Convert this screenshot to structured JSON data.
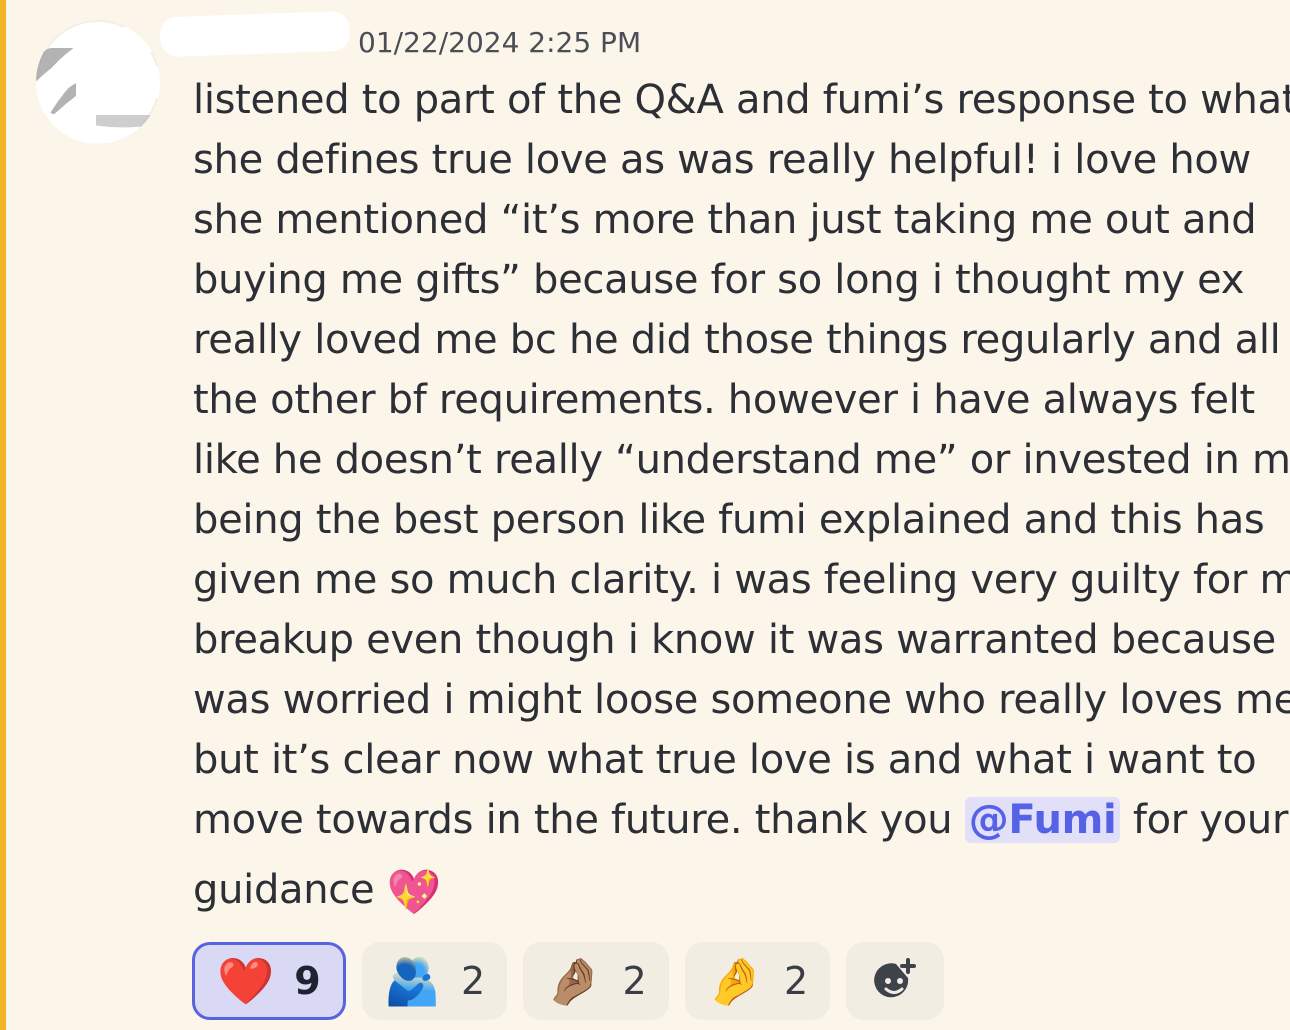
{
  "message": {
    "timestamp": "01/22/2024 2:25 PM",
    "lines": [
      "listened to part of the Q&A and fumi’s response to what",
      "she defines true love as was really helpful! i love how",
      "she mentioned “it’s more than just taking me out and",
      "buying me gifts” because for so long i thought my ex",
      "really loved me bc he did those things regularly and all",
      "the other bf requirements. however i have always felt",
      "like he doesn’t really “understand me” or invested in me",
      "being the best person like fumi explained and this has",
      "given me so much clarity. i was feeling very guilty for my",
      "breakup even though i know it was warranted because i",
      "was worried i might loose someone who really loves me.",
      "but it’s clear now what true love is and what i want to"
    ],
    "line13_before": "move towards in the future. thank you ",
    "mention": "@Fumi",
    "line13_after": " for your",
    "line14_text": "guidance ",
    "line14_emoji": "💖"
  },
  "reactions": [
    {
      "emoji": "❤️",
      "name": "heart",
      "count": "9",
      "active": true
    },
    {
      "emoji": "🫂",
      "name": "people-hugging",
      "count": "2",
      "active": false
    },
    {
      "emoji": "🤌🏽",
      "name": "pinched-fingers-medium",
      "count": "2",
      "active": false
    },
    {
      "emoji": "🤌",
      "name": "pinched-fingers",
      "count": "2",
      "active": false
    }
  ],
  "add_reaction": {
    "icon": "add-reaction-icon"
  },
  "colors": {
    "background": "#fbf5ea",
    "highlight_bar": "#f2b429",
    "mention_bg": "#e2e0f8",
    "mention_text": "#5662e6",
    "active_reaction_border": "#5863e0"
  }
}
